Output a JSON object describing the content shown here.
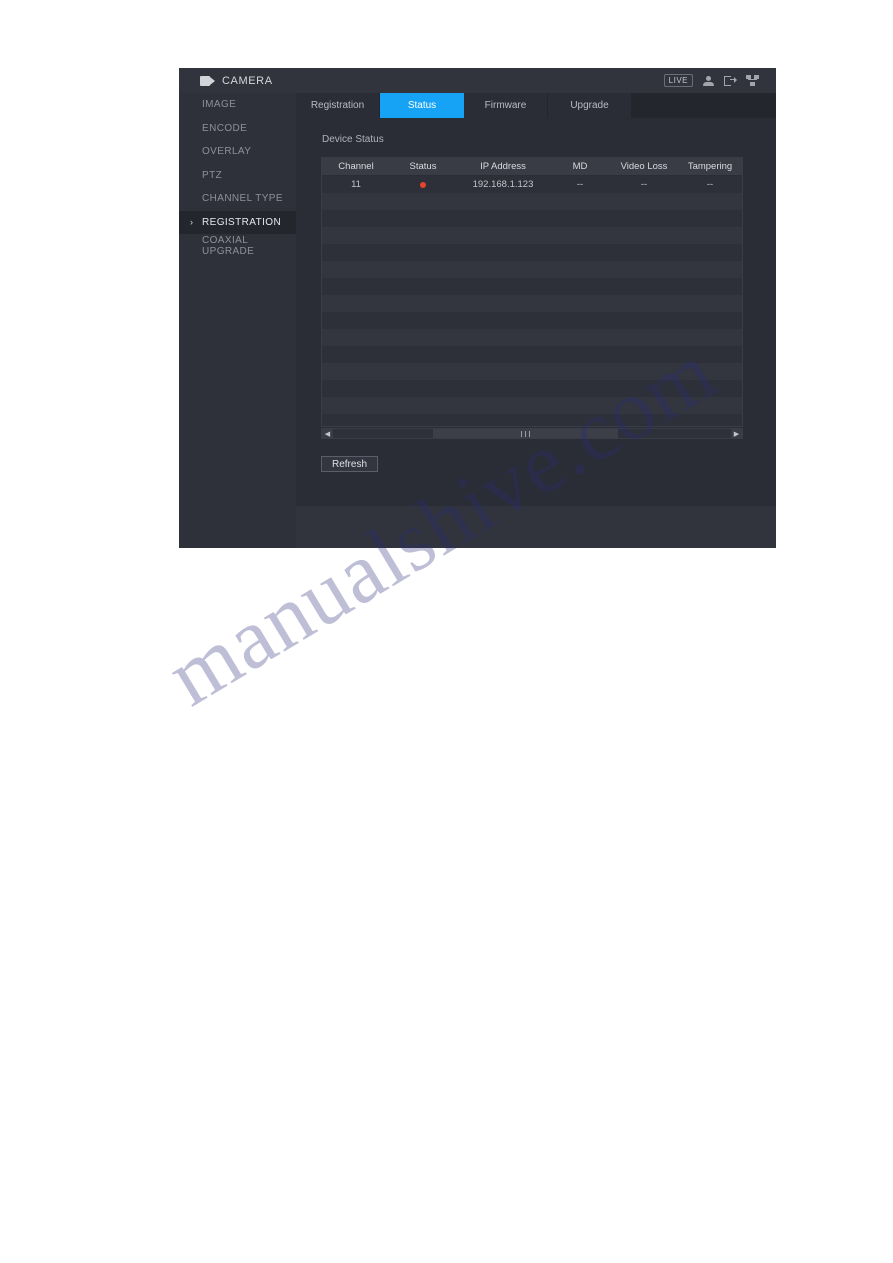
{
  "window": {
    "title": "CAMERA",
    "title_icon": "video-camera-icon",
    "live_badge": "LIVE",
    "icons": [
      "user-icon",
      "logout-icon",
      "network-icon"
    ]
  },
  "sidebar": {
    "items": [
      {
        "label": "IMAGE",
        "active": false
      },
      {
        "label": "ENCODE",
        "active": false
      },
      {
        "label": "OVERLAY",
        "active": false
      },
      {
        "label": "PTZ",
        "active": false
      },
      {
        "label": "CHANNEL TYPE",
        "active": false
      },
      {
        "label": "REGISTRATION",
        "active": true
      },
      {
        "label": "COAXIAL UPGRADE",
        "active": false
      }
    ]
  },
  "tabs": [
    {
      "label": "Registration",
      "active": false
    },
    {
      "label": "Status",
      "active": true
    },
    {
      "label": "Firmware",
      "active": false
    },
    {
      "label": "Upgrade",
      "active": false
    }
  ],
  "panel": {
    "title": "Device Status",
    "table": {
      "columns": [
        "Channel",
        "Status",
        "IP Address",
        "MD",
        "Video Loss",
        "Tampering"
      ],
      "rows": [
        {
          "channel": "11",
          "status": "alarm",
          "ip_address": "192.168.1.123",
          "md": "--",
          "video_loss": "--",
          "tampering": "--"
        }
      ],
      "empty_row_count": 15
    },
    "scrollbar": {
      "left_arrow": "◀",
      "right_arrow": "▶"
    },
    "refresh_label": "Refresh"
  },
  "colors": {
    "accent": "#17a3f5",
    "alarm": "#e8422e",
    "window_bg": "#2b2d36",
    "sidebar_bg": "#2f313a"
  },
  "watermark": {
    "text": "manualshive.com"
  }
}
